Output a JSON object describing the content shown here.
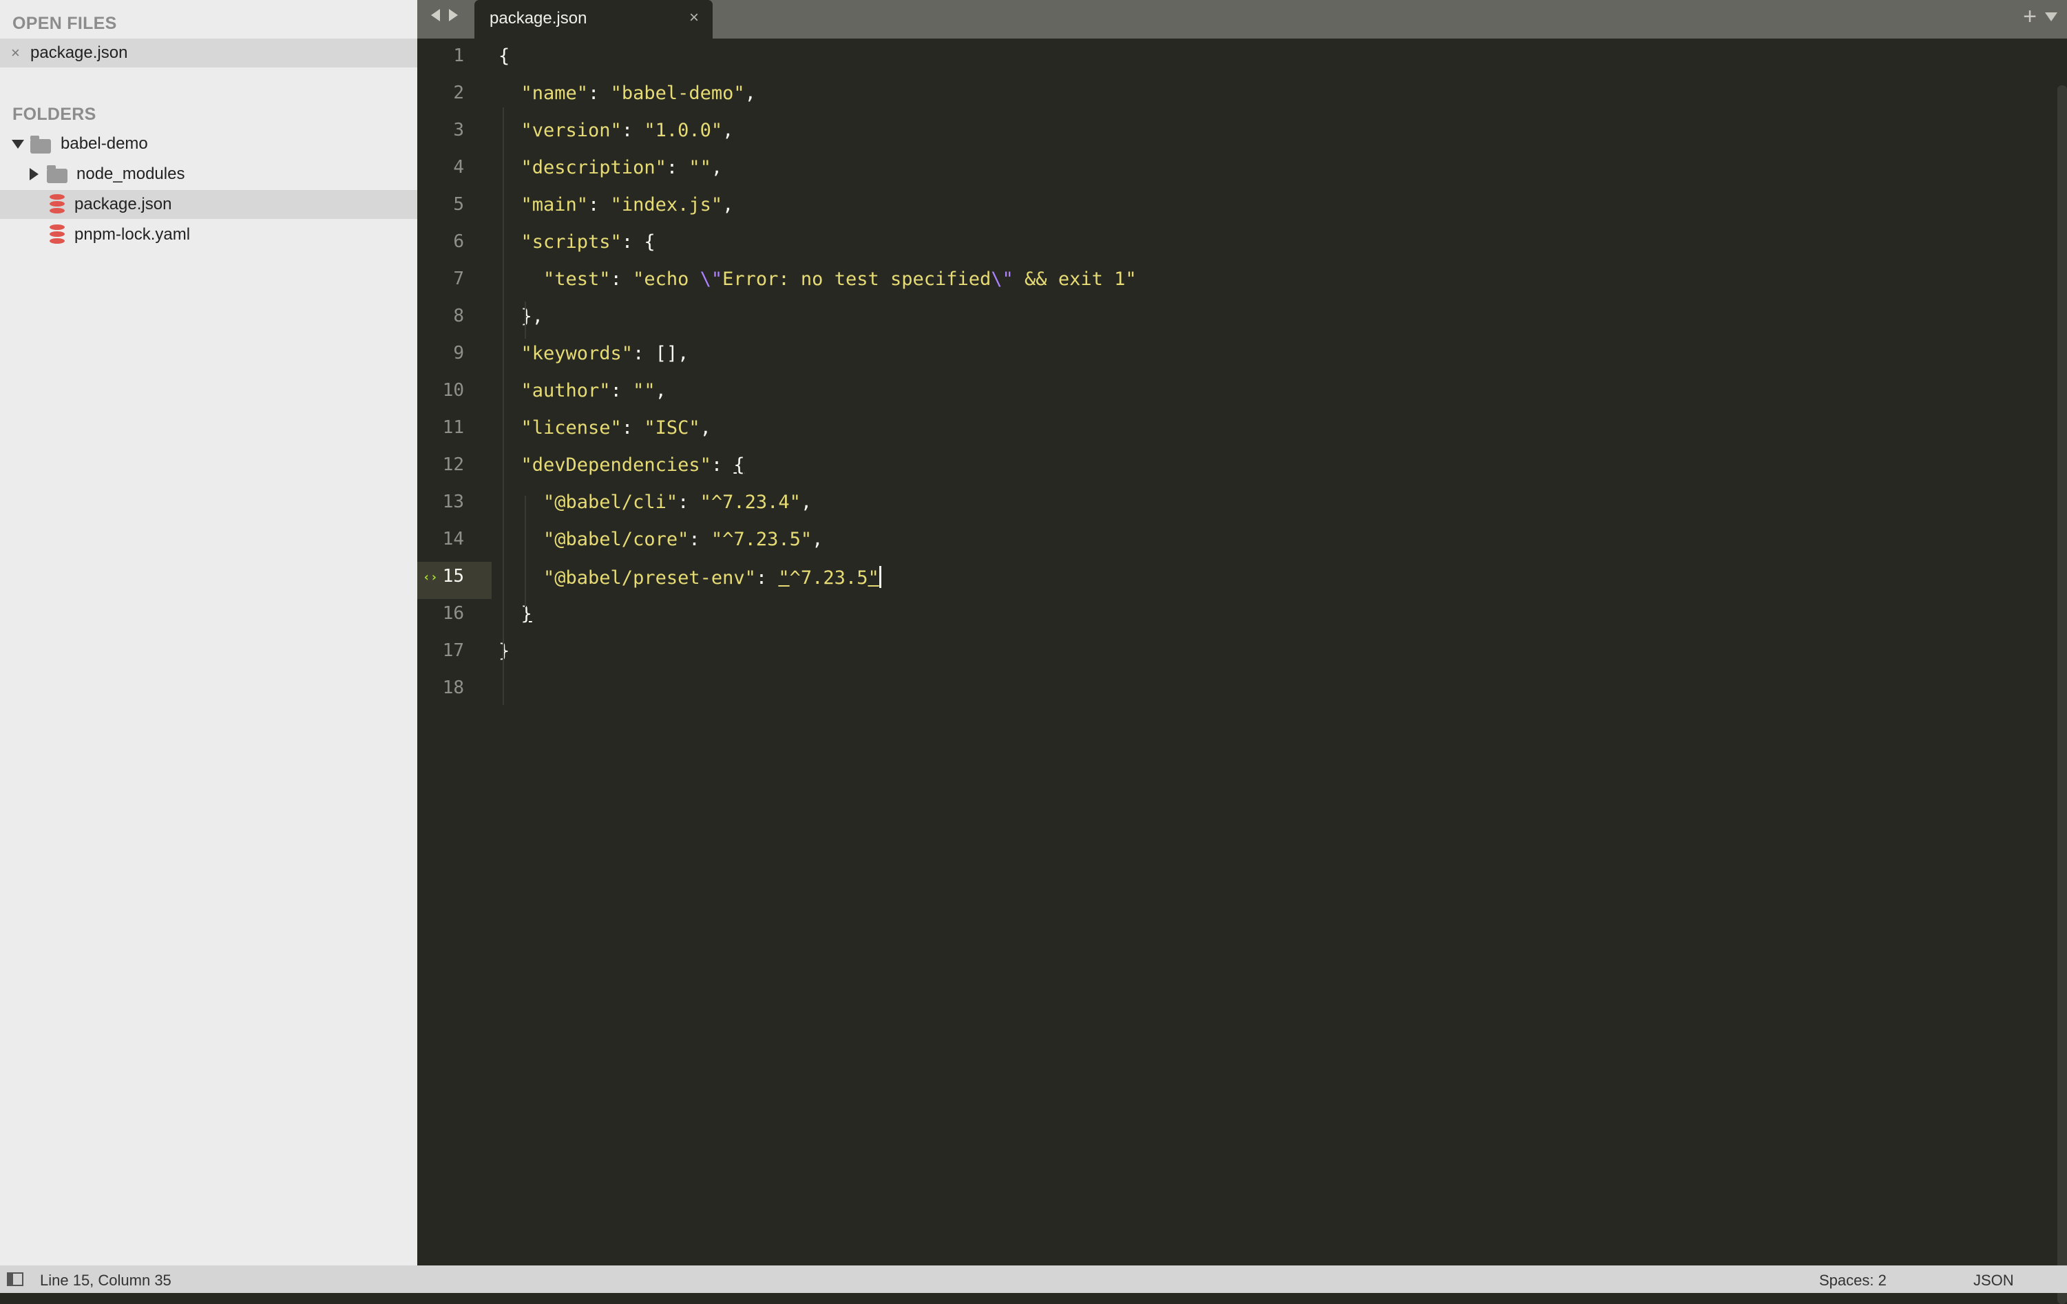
{
  "sidebar": {
    "open_files_header": "OPEN FILES",
    "open_files": [
      {
        "name": "package.json",
        "close_glyph": "×"
      }
    ],
    "folders_header": "FOLDERS",
    "tree": [
      {
        "name": "babel-demo",
        "type": "folder",
        "state": "expanded"
      },
      {
        "name": "node_modules",
        "type": "folder",
        "state": "collapsed"
      },
      {
        "name": "package.json",
        "type": "file"
      },
      {
        "name": "pnpm-lock.yaml",
        "type": "file"
      }
    ]
  },
  "tabbar": {
    "active_tab": "package.json",
    "close_glyph": "×",
    "new_tab_glyph": "+"
  },
  "editor": {
    "active_line_marker": "‹›",
    "line_numbers": [
      "1",
      "2",
      "3",
      "4",
      "5",
      "6",
      "7",
      "8",
      "9",
      "10",
      "11",
      "12",
      "13",
      "14",
      "15",
      "16",
      "17",
      "18"
    ],
    "active_line": 15,
    "lines": [
      [
        {
          "t": "p",
          "v": "{"
        }
      ],
      [
        {
          "t": "k",
          "v": "  \"name\""
        },
        {
          "t": "p",
          "v": ": "
        },
        {
          "t": "s",
          "v": "\"babel-demo\""
        },
        {
          "t": "p",
          "v": ","
        }
      ],
      [
        {
          "t": "k",
          "v": "  \"version\""
        },
        {
          "t": "p",
          "v": ": "
        },
        {
          "t": "s",
          "v": "\"1.0.0\""
        },
        {
          "t": "p",
          "v": ","
        }
      ],
      [
        {
          "t": "k",
          "v": "  \"description\""
        },
        {
          "t": "p",
          "v": ": "
        },
        {
          "t": "s",
          "v": "\"\""
        },
        {
          "t": "p",
          "v": ","
        }
      ],
      [
        {
          "t": "k",
          "v": "  \"main\""
        },
        {
          "t": "p",
          "v": ": "
        },
        {
          "t": "s",
          "v": "\"index.js\""
        },
        {
          "t": "p",
          "v": ","
        }
      ],
      [
        {
          "t": "k",
          "v": "  \"scripts\""
        },
        {
          "t": "p",
          "v": ": {"
        }
      ],
      [
        {
          "t": "k",
          "v": "    \"test\""
        },
        {
          "t": "p",
          "v": ": "
        },
        {
          "t": "s",
          "v": "\"echo "
        },
        {
          "t": "esc",
          "v": "\\\""
        },
        {
          "t": "s",
          "v": "Error: no test specified"
        },
        {
          "t": "esc",
          "v": "\\\""
        },
        {
          "t": "s",
          "v": " && exit 1\""
        }
      ],
      [
        {
          "t": "p",
          "v": "  },"
        }
      ],
      [
        {
          "t": "k",
          "v": "  \"keywords\""
        },
        {
          "t": "p",
          "v": ": [],"
        }
      ],
      [
        {
          "t": "k",
          "v": "  \"author\""
        },
        {
          "t": "p",
          "v": ": "
        },
        {
          "t": "s",
          "v": "\"\""
        },
        {
          "t": "p",
          "v": ","
        }
      ],
      [
        {
          "t": "k",
          "v": "  \"license\""
        },
        {
          "t": "p",
          "v": ": "
        },
        {
          "t": "s",
          "v": "\"ISC\""
        },
        {
          "t": "p",
          "v": ","
        }
      ],
      [
        {
          "t": "k",
          "v": "  \"devDependencies\""
        },
        {
          "t": "p",
          "v": ": "
        },
        {
          "t": "p",
          "v": "{",
          "u": true
        }
      ],
      [
        {
          "t": "k",
          "v": "    \"@babel/cli\""
        },
        {
          "t": "p",
          "v": ": "
        },
        {
          "t": "s",
          "v": "\"^7.23.4\""
        },
        {
          "t": "p",
          "v": ","
        }
      ],
      [
        {
          "t": "k",
          "v": "    \"@babel/core\""
        },
        {
          "t": "p",
          "v": ": "
        },
        {
          "t": "s",
          "v": "\"^7.23.5\""
        },
        {
          "t": "p",
          "v": ","
        }
      ],
      [
        {
          "t": "k",
          "v": "    \"@babel/preset-env\""
        },
        {
          "t": "p",
          "v": ": "
        },
        {
          "t": "s",
          "v": "\"",
          "u": true
        },
        {
          "t": "s",
          "v": "^7.23.5"
        },
        {
          "t": "s",
          "v": "\"",
          "u": true
        },
        {
          "t": "cursor",
          "v": ""
        }
      ],
      [
        {
          "t": "p",
          "v": "  "
        },
        {
          "t": "p",
          "v": "}",
          "u": true
        }
      ],
      [
        {
          "t": "p",
          "v": "}"
        }
      ],
      []
    ]
  },
  "statusbar": {
    "position": "Line 15, Column 35",
    "indentation": "Spaces: 2",
    "syntax": "JSON"
  },
  "colors": {
    "editor_bg": "#272822",
    "sidebar_bg": "#ececec",
    "string": "#e6db74",
    "escape": "#ae81ff",
    "active_line_marker": "#a6e22e"
  }
}
